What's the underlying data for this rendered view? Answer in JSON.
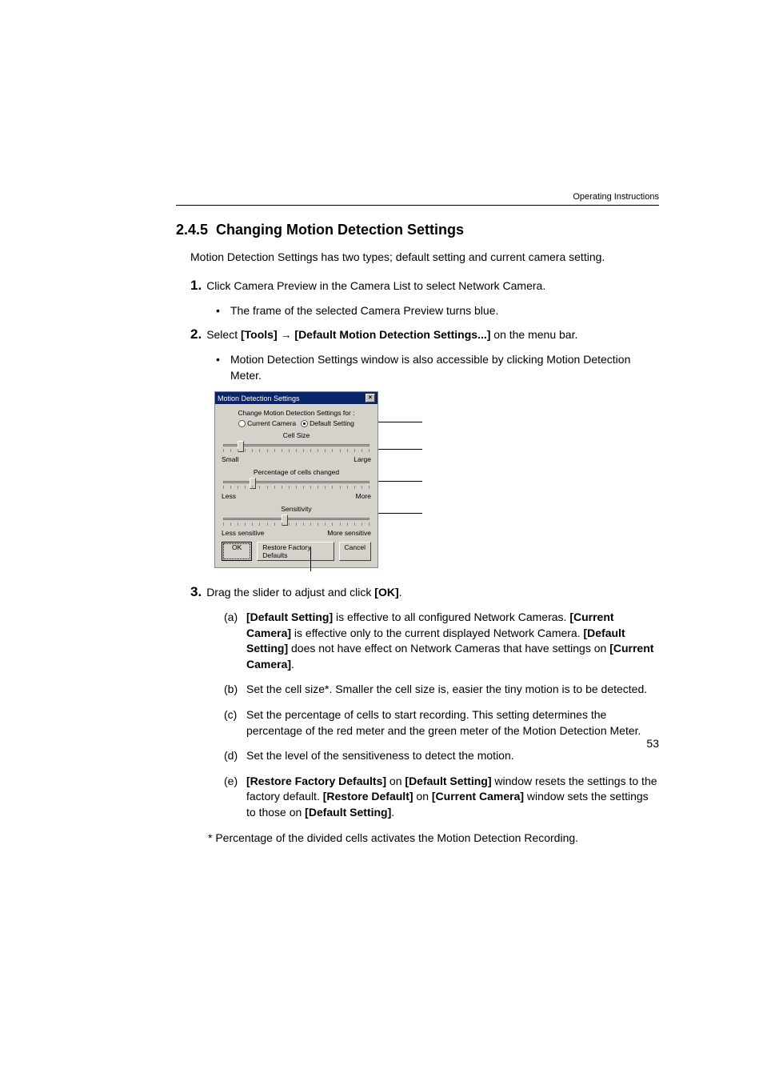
{
  "header": {
    "label": "Operating Instructions"
  },
  "section": {
    "number": "2.4.5",
    "title": "Changing Motion Detection Settings"
  },
  "intro": "Motion Detection Settings has two types; default setting and current camera setting.",
  "steps": {
    "1": {
      "num": "1.",
      "text_pre": "Click Camera Preview in the Camera List to select Network Camera.",
      "bullet": "The frame of the selected Camera Preview turns blue."
    },
    "2": {
      "num": "2.",
      "before_select": "Select ",
      "tools": "[Tools]",
      "arrow": " → ",
      "default_menu": "[Default Motion Detection Settings...]",
      "after": " on the menu bar.",
      "bullet": "Motion Detection Settings window is also accessible by clicking Motion Detection Meter."
    },
    "3": {
      "num": "3.",
      "before": "Drag the slider to adjust and click ",
      "ok": "[OK]",
      "after": "."
    }
  },
  "dialog": {
    "title": "Motion Detection Settings",
    "change_label": "Change Motion Detection Settings for :",
    "radio_current": "Current Camera",
    "radio_default": "Default Setting",
    "cell_size": "Cell Size",
    "small": "Small",
    "large": "Large",
    "pct": "Percentage of cells changed",
    "less": "Less",
    "more": "More",
    "sensitivity": "Sensitivity",
    "less_sens": "Less sensitive",
    "more_sens": "More sensitive",
    "ok": "OK",
    "restore": "Restore Factory Defaults",
    "cancel": "Cancel"
  },
  "alpha": {
    "a": {
      "marker": "(a)",
      "s1": "[Default Setting]",
      "t1": " is effective to all configured Network Cameras. ",
      "s2": "[Current Camera]",
      "t2": " is effective only to the current displayed Network Camera. ",
      "s3": "[Default Setting]",
      "t3": " does not have effect on Network Cameras that have settings on ",
      "s4": "[Current Camera]",
      "t4": "."
    },
    "b": {
      "marker": "(b)",
      "text": "Set the cell size*. Smaller the cell size is, easier the tiny motion is to be detected."
    },
    "c": {
      "marker": "(c)",
      "text": "Set the percentage of cells to start recording. This setting determines the percentage of the red meter and the green meter of the Motion Detection Meter."
    },
    "d": {
      "marker": "(d)",
      "text": "Set the level of the sensitiveness to detect the motion."
    },
    "e": {
      "marker": "(e)",
      "s1": "[Restore Factory Defaults]",
      "t1": " on ",
      "s2": "[Default Setting]",
      "t2": " window resets the settings to the factory default. ",
      "s3": "[Restore Default]",
      "t3": " on ",
      "s4": "[Current Camera]",
      "t4": " window sets the settings to those on ",
      "s5": "[Default Setting]",
      "t5": "."
    }
  },
  "footnote": "* Percentage of the divided cells activates the Motion Detection Recording.",
  "page_number": "53"
}
